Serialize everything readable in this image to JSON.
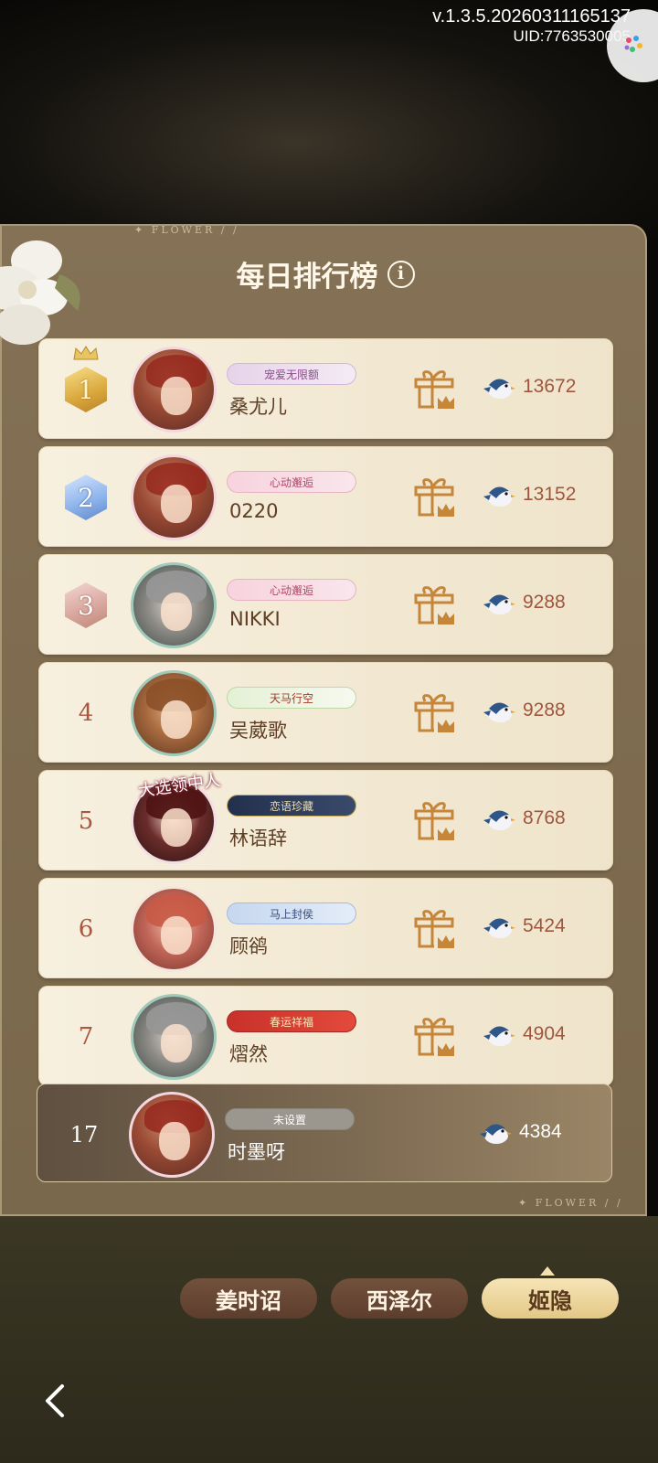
{
  "status": {
    "version": "v.1.3.5.20260311165137",
    "uid": "UID:7763530005"
  },
  "panel": {
    "title": "每日排行榜",
    "deco": "FLOWER"
  },
  "rows": [
    {
      "rank": "1",
      "name": "桑尤儿",
      "badge": "宠爱无限额",
      "score": "13672"
    },
    {
      "rank": "2",
      "name": "0220",
      "badge": "心动邂逅",
      "score": "13152"
    },
    {
      "rank": "3",
      "name": "NIKKI",
      "badge": "心动邂逅",
      "score": "9288"
    },
    {
      "rank": "4",
      "name": "吴葳歌",
      "badge": "天马行空",
      "score": "9288"
    },
    {
      "rank": "5",
      "name": "林语辞",
      "badge": "恋语珍藏",
      "score": "8768",
      "avatar_banner": "大选领中人"
    },
    {
      "rank": "6",
      "name": "顾鹆",
      "badge": "马上封侯",
      "score": "5424"
    },
    {
      "rank": "7",
      "name": "熠然",
      "badge": "春运祥福",
      "score": "4904"
    }
  ],
  "my_rank": {
    "rank": "17",
    "name": "时墨呀",
    "badge": "未设置",
    "score": "4384"
  },
  "tabs": [
    {
      "label": "姜时诏",
      "active": false
    },
    {
      "label": "西泽尔",
      "active": false
    },
    {
      "label": "姬隐",
      "active": true
    }
  ],
  "colors": {
    "accent_gold": "#e3c886",
    "score_text": "#a0563e",
    "panel_bg": "#857256"
  },
  "icons": {
    "info": "info-icon",
    "gift": "gift-crown-icon",
    "bird": "bird-icon",
    "back": "back-chevron-icon"
  }
}
